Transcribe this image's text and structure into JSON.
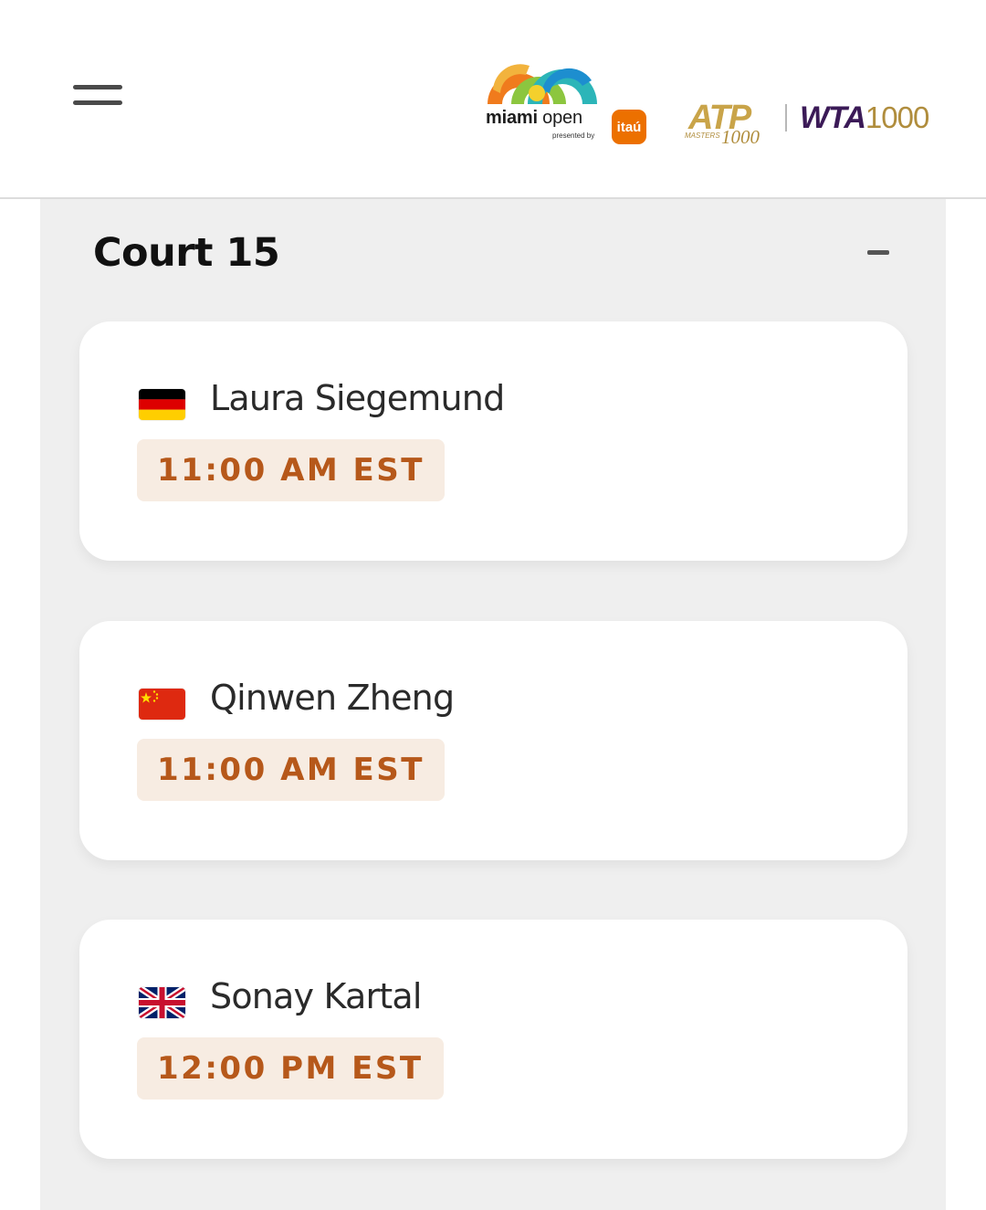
{
  "header": {
    "menu_icon": "hamburger-menu-icon",
    "sponsor_logos": {
      "miami_open": {
        "name_bold": "miami",
        "name_regular": " open",
        "tagline": "presented by"
      },
      "itau": {
        "text": "itaú",
        "color": "#ec7000"
      },
      "atp": {
        "text": "ATP",
        "masters": "MASTERS",
        "number": "1000"
      },
      "wta": {
        "text": "WTA",
        "number": "1000",
        "color": "#3b1a57"
      }
    }
  },
  "court": {
    "title": "Court 15",
    "collapse_icon": "minus-icon",
    "matches": [
      {
        "player": "Laura Siegemund",
        "flag": "germany-flag-icon",
        "time": "11:00 AM EST"
      },
      {
        "player": "Qinwen Zheng",
        "flag": "china-flag-icon",
        "time": "11:00 AM EST"
      },
      {
        "player": "Sonay Kartal",
        "flag": "uk-flag-icon",
        "time": "12:00 PM EST"
      }
    ]
  },
  "colors": {
    "accent_time_text": "#b6581a",
    "time_badge_bg": "#f7ece2",
    "panel_bg": "#efefef"
  }
}
